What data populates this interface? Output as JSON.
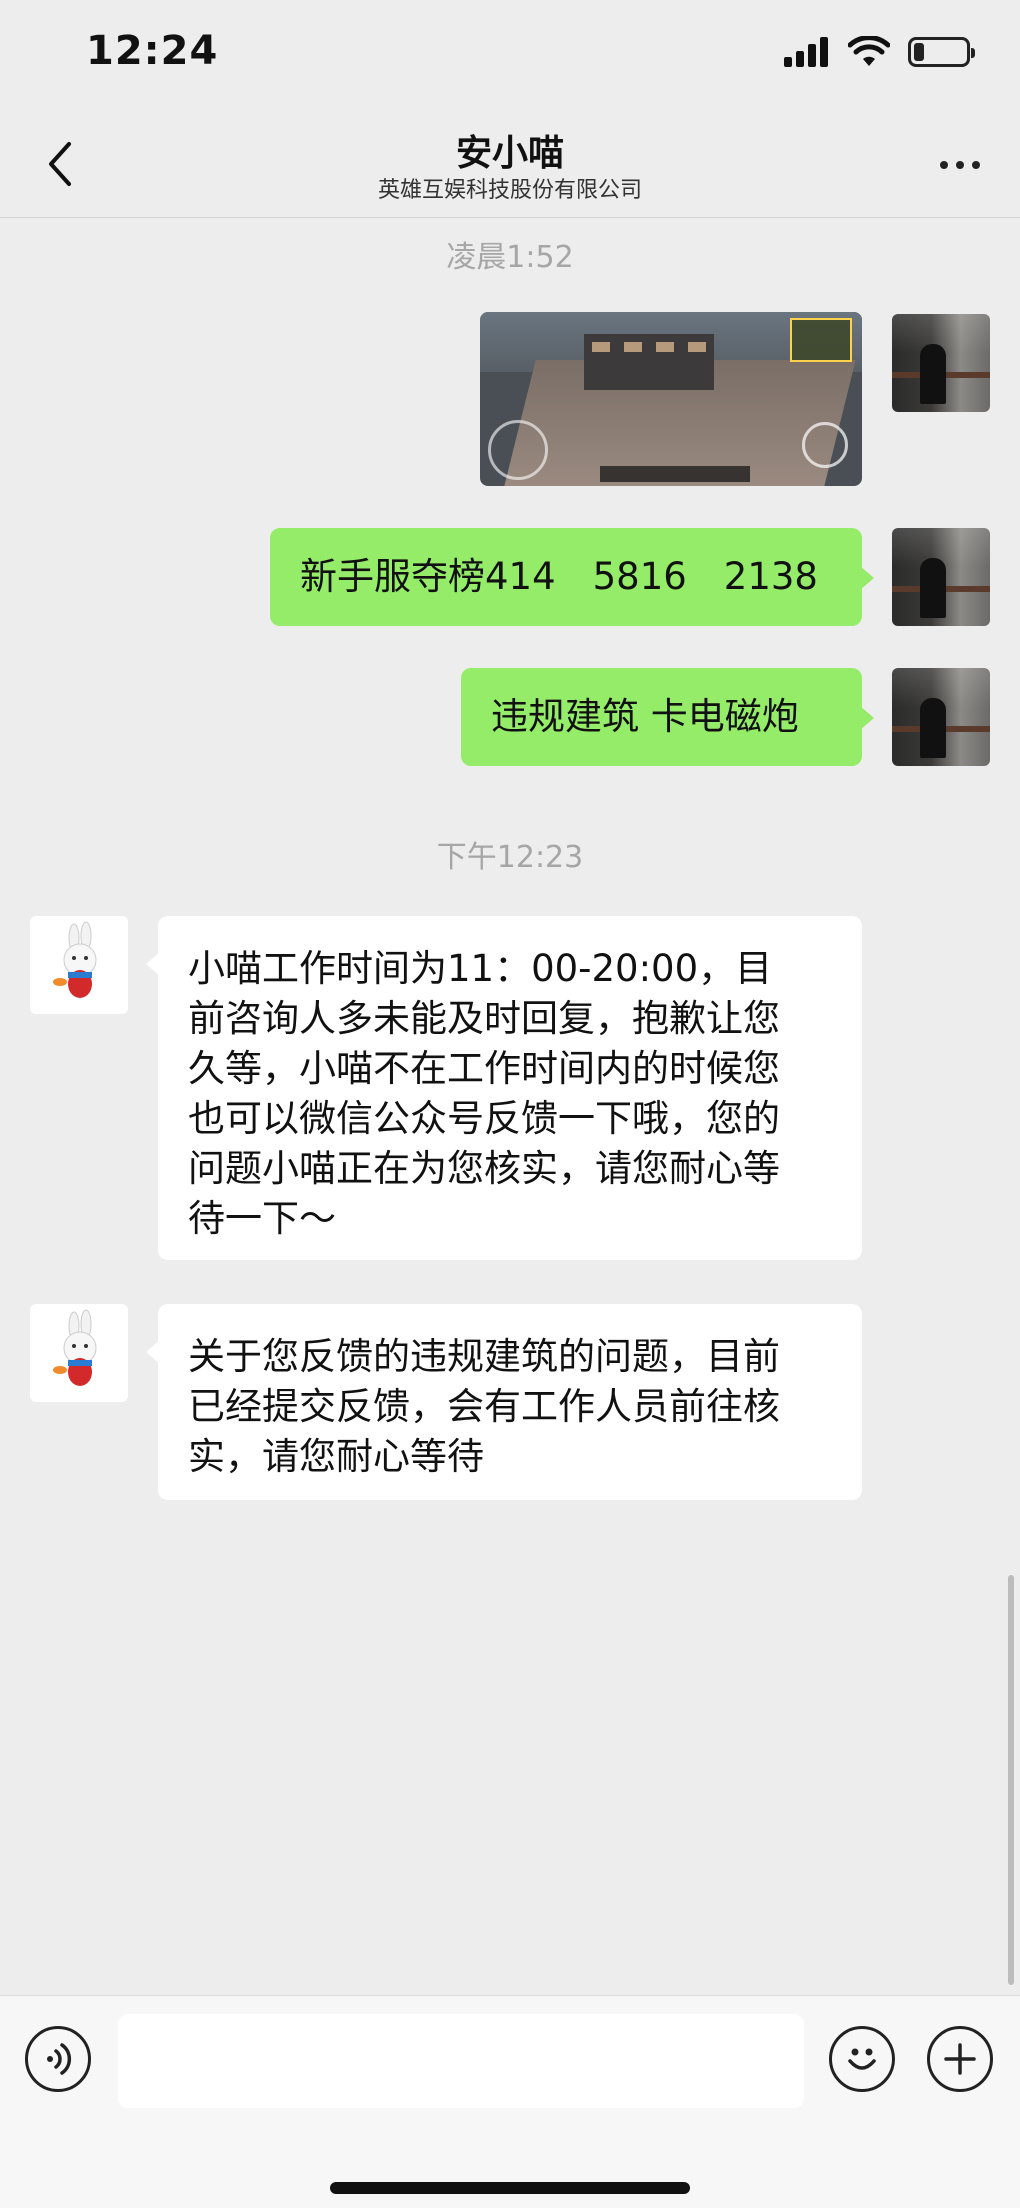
{
  "status": {
    "time": "12:24",
    "battery_level": 0.2
  },
  "header": {
    "title": "安小喵",
    "subtitle": "英雄互娱科技股份有限公司",
    "back_icon": "chevron-left-icon",
    "more_icon": "ellipsis-icon"
  },
  "messages": {
    "ts1": "凌晨1:52",
    "ts2": "下午12:23",
    "m2": "新手服夺榜414　5816　2138",
    "m3": "违规建筑 卡电磁炮",
    "m4": "小喵工作时间为11：00-20:00，目\n前咨询人多未能及时回复，抱歉让您\n久等，小喵不在工作时间内的时候您\n也可以微信公众号反馈一下哦，您的\n问题小喵正在为您核实，请您耐心等\n待一下～",
    "m5": "关于您反馈的违规建筑的问题，目前\n已经提交反馈，会有工作人员前往核\n实，请您耐心等待"
  },
  "input": {
    "value": "",
    "placeholder": ""
  },
  "colors": {
    "self_bubble": "#95ec69",
    "other_bubble": "#ffffff",
    "background": "#ededed"
  }
}
